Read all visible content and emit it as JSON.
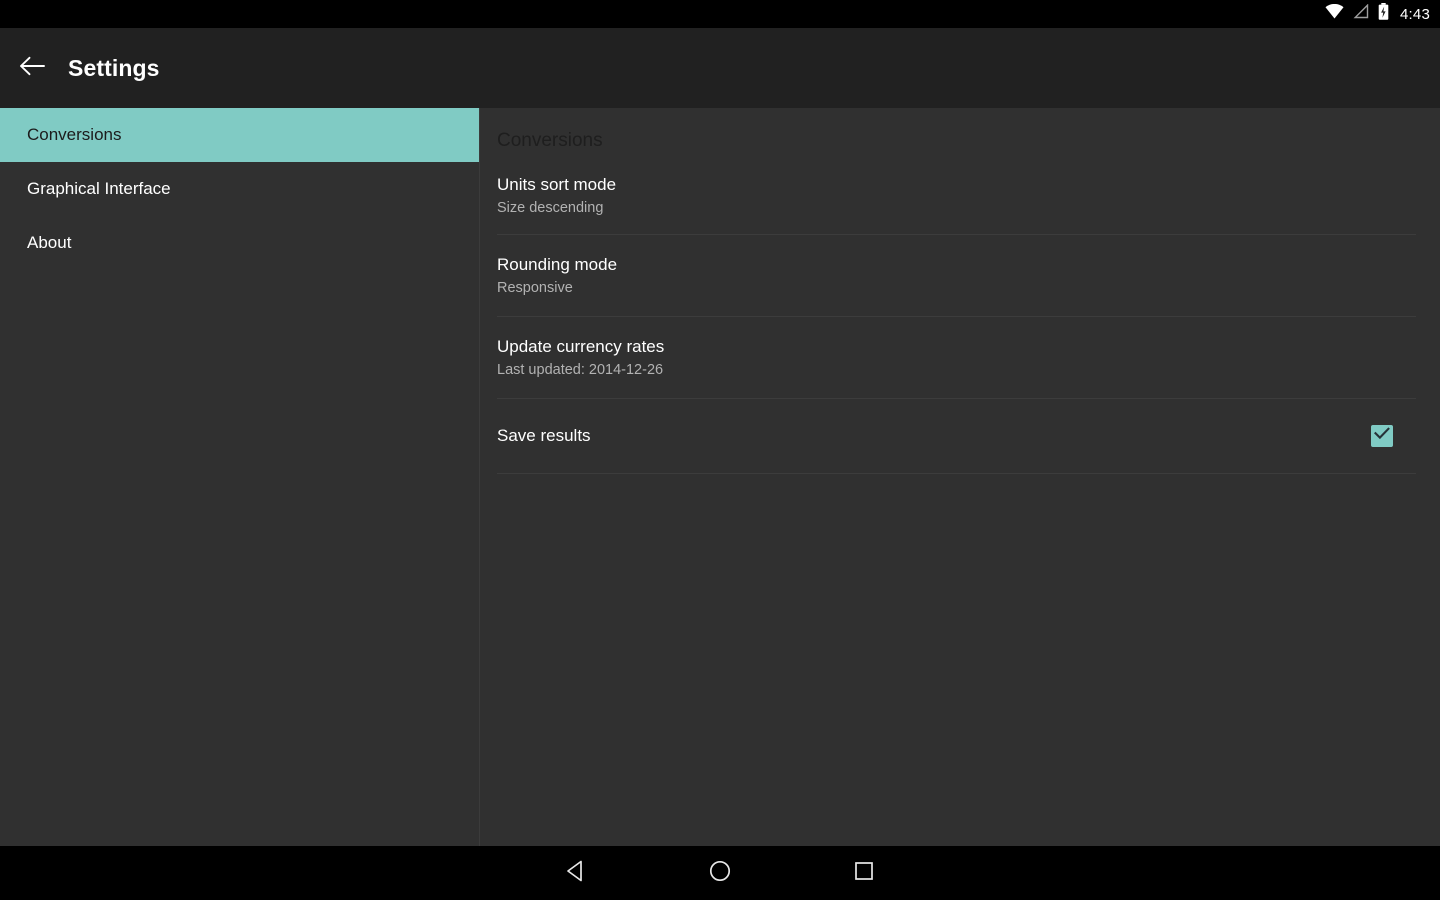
{
  "status_bar": {
    "time": "4:43",
    "icons": [
      "wifi-icon",
      "signal-icon",
      "battery-charging-icon"
    ]
  },
  "action_bar": {
    "back_icon": "arrow-left-icon",
    "title": "Settings"
  },
  "sidebar": {
    "items": [
      {
        "label": "Conversions",
        "selected": true
      },
      {
        "label": "Graphical Interface",
        "selected": false
      },
      {
        "label": "About",
        "selected": false
      }
    ]
  },
  "content": {
    "header": "Conversions",
    "preferences": [
      {
        "title": "Units sort mode",
        "summary": "Size descending",
        "type": "list"
      },
      {
        "title": "Rounding mode",
        "summary": "Responsive",
        "type": "list"
      },
      {
        "title": "Update currency rates",
        "summary": "Last updated: 2014-12-26",
        "type": "action"
      },
      {
        "title": "Save results",
        "summary": "",
        "type": "checkbox",
        "checked": true
      }
    ]
  },
  "nav_bar": {
    "back_label": "back-triangle-icon",
    "home_label": "home-circle-icon",
    "recents_label": "recents-square-icon"
  },
  "colors": {
    "accent": "#80cbc4",
    "background": "#303030",
    "action_bar": "#212121",
    "nav_bar": "#000000",
    "title_text": "#ffffff",
    "summary_text": "#b2b2b2",
    "header_text": "#1e1e1e"
  }
}
